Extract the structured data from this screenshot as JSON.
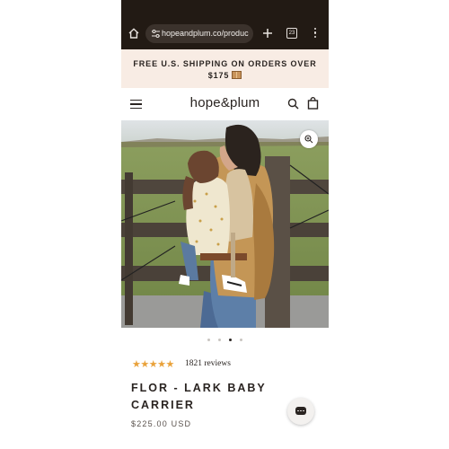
{
  "browser": {
    "url": "hopeandplum.co/produc",
    "tab_count": "23",
    "icons": [
      "home-icon",
      "tune-icon",
      "plus-icon",
      "tabs-icon",
      "more-vert-icon"
    ],
    "bar_color": "#221a14"
  },
  "promo": {
    "text": "FREE U.S. SHIPPING ON ORDERS OVER $175",
    "background": "#f8ece4"
  },
  "header": {
    "brand": "hope&plum",
    "icons": [
      "menu-icon",
      "search-icon",
      "shopping-bag-icon"
    ]
  },
  "gallery": {
    "image_count": 4,
    "active_index": 3,
    "icons": [
      "zoom-icon"
    ]
  },
  "product": {
    "rating": 4.5,
    "stars": "★★★★★",
    "reviews_label": "1821 reviews",
    "title": "FLOR - LARK BABY CARRIER",
    "price": "$225.00 USD",
    "star_color": "#e9a23b"
  },
  "chat": {
    "icon": "chat-icon"
  }
}
